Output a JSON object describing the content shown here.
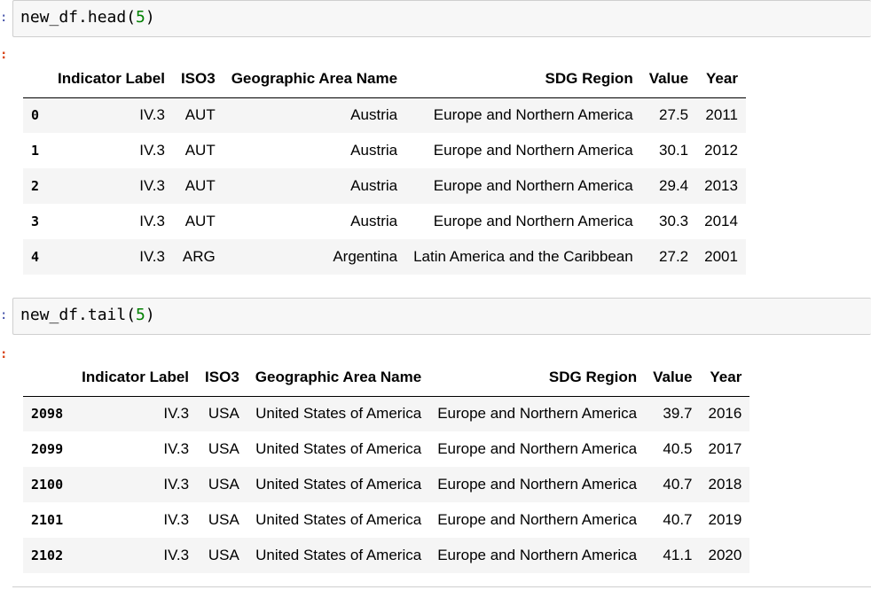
{
  "cells": [
    {
      "input_prompt": ":",
      "output_prompt": ":",
      "code_prefix": "new_df.head(",
      "code_arg": "5",
      "code_suffix": ")",
      "table": {
        "columns": [
          "",
          "Indicator Label",
          "ISO3",
          "Geographic Area Name",
          "SDG Region",
          "Value",
          "Year"
        ],
        "rows": [
          {
            "index": "0",
            "indicator": "IV.3",
            "iso3": "AUT",
            "area": "Austria",
            "region": "Europe and Northern America",
            "value": "27.5",
            "year": "2011"
          },
          {
            "index": "1",
            "indicator": "IV.3",
            "iso3": "AUT",
            "area": "Austria",
            "region": "Europe and Northern America",
            "value": "30.1",
            "year": "2012"
          },
          {
            "index": "2",
            "indicator": "IV.3",
            "iso3": "AUT",
            "area": "Austria",
            "region": "Europe and Northern America",
            "value": "29.4",
            "year": "2013"
          },
          {
            "index": "3",
            "indicator": "IV.3",
            "iso3": "AUT",
            "area": "Austria",
            "region": "Europe and Northern America",
            "value": "30.3",
            "year": "2014"
          },
          {
            "index": "4",
            "indicator": "IV.3",
            "iso3": "ARG",
            "area": "Argentina",
            "region": "Latin America and the Caribbean",
            "value": "27.2",
            "year": "2001"
          }
        ]
      }
    },
    {
      "input_prompt": ":",
      "output_prompt": ":",
      "code_prefix": "new_df.tail(",
      "code_arg": "5",
      "code_suffix": ")",
      "table": {
        "columns": [
          "",
          "Indicator Label",
          "ISO3",
          "Geographic Area Name",
          "SDG Region",
          "Value",
          "Year"
        ],
        "rows": [
          {
            "index": "2098",
            "indicator": "IV.3",
            "iso3": "USA",
            "area": "United States of America",
            "region": "Europe and Northern America",
            "value": "39.7",
            "year": "2016"
          },
          {
            "index": "2099",
            "indicator": "IV.3",
            "iso3": "USA",
            "area": "United States of America",
            "region": "Europe and Northern America",
            "value": "40.5",
            "year": "2017"
          },
          {
            "index": "2100",
            "indicator": "IV.3",
            "iso3": "USA",
            "area": "United States of America",
            "region": "Europe and Northern America",
            "value": "40.7",
            "year": "2018"
          },
          {
            "index": "2101",
            "indicator": "IV.3",
            "iso3": "USA",
            "area": "United States of America",
            "region": "Europe and Northern America",
            "value": "40.7",
            "year": "2019"
          },
          {
            "index": "2102",
            "indicator": "IV.3",
            "iso3": "USA",
            "area": "United States of America",
            "region": "Europe and Northern America",
            "value": "41.1",
            "year": "2020"
          }
        ]
      }
    }
  ]
}
